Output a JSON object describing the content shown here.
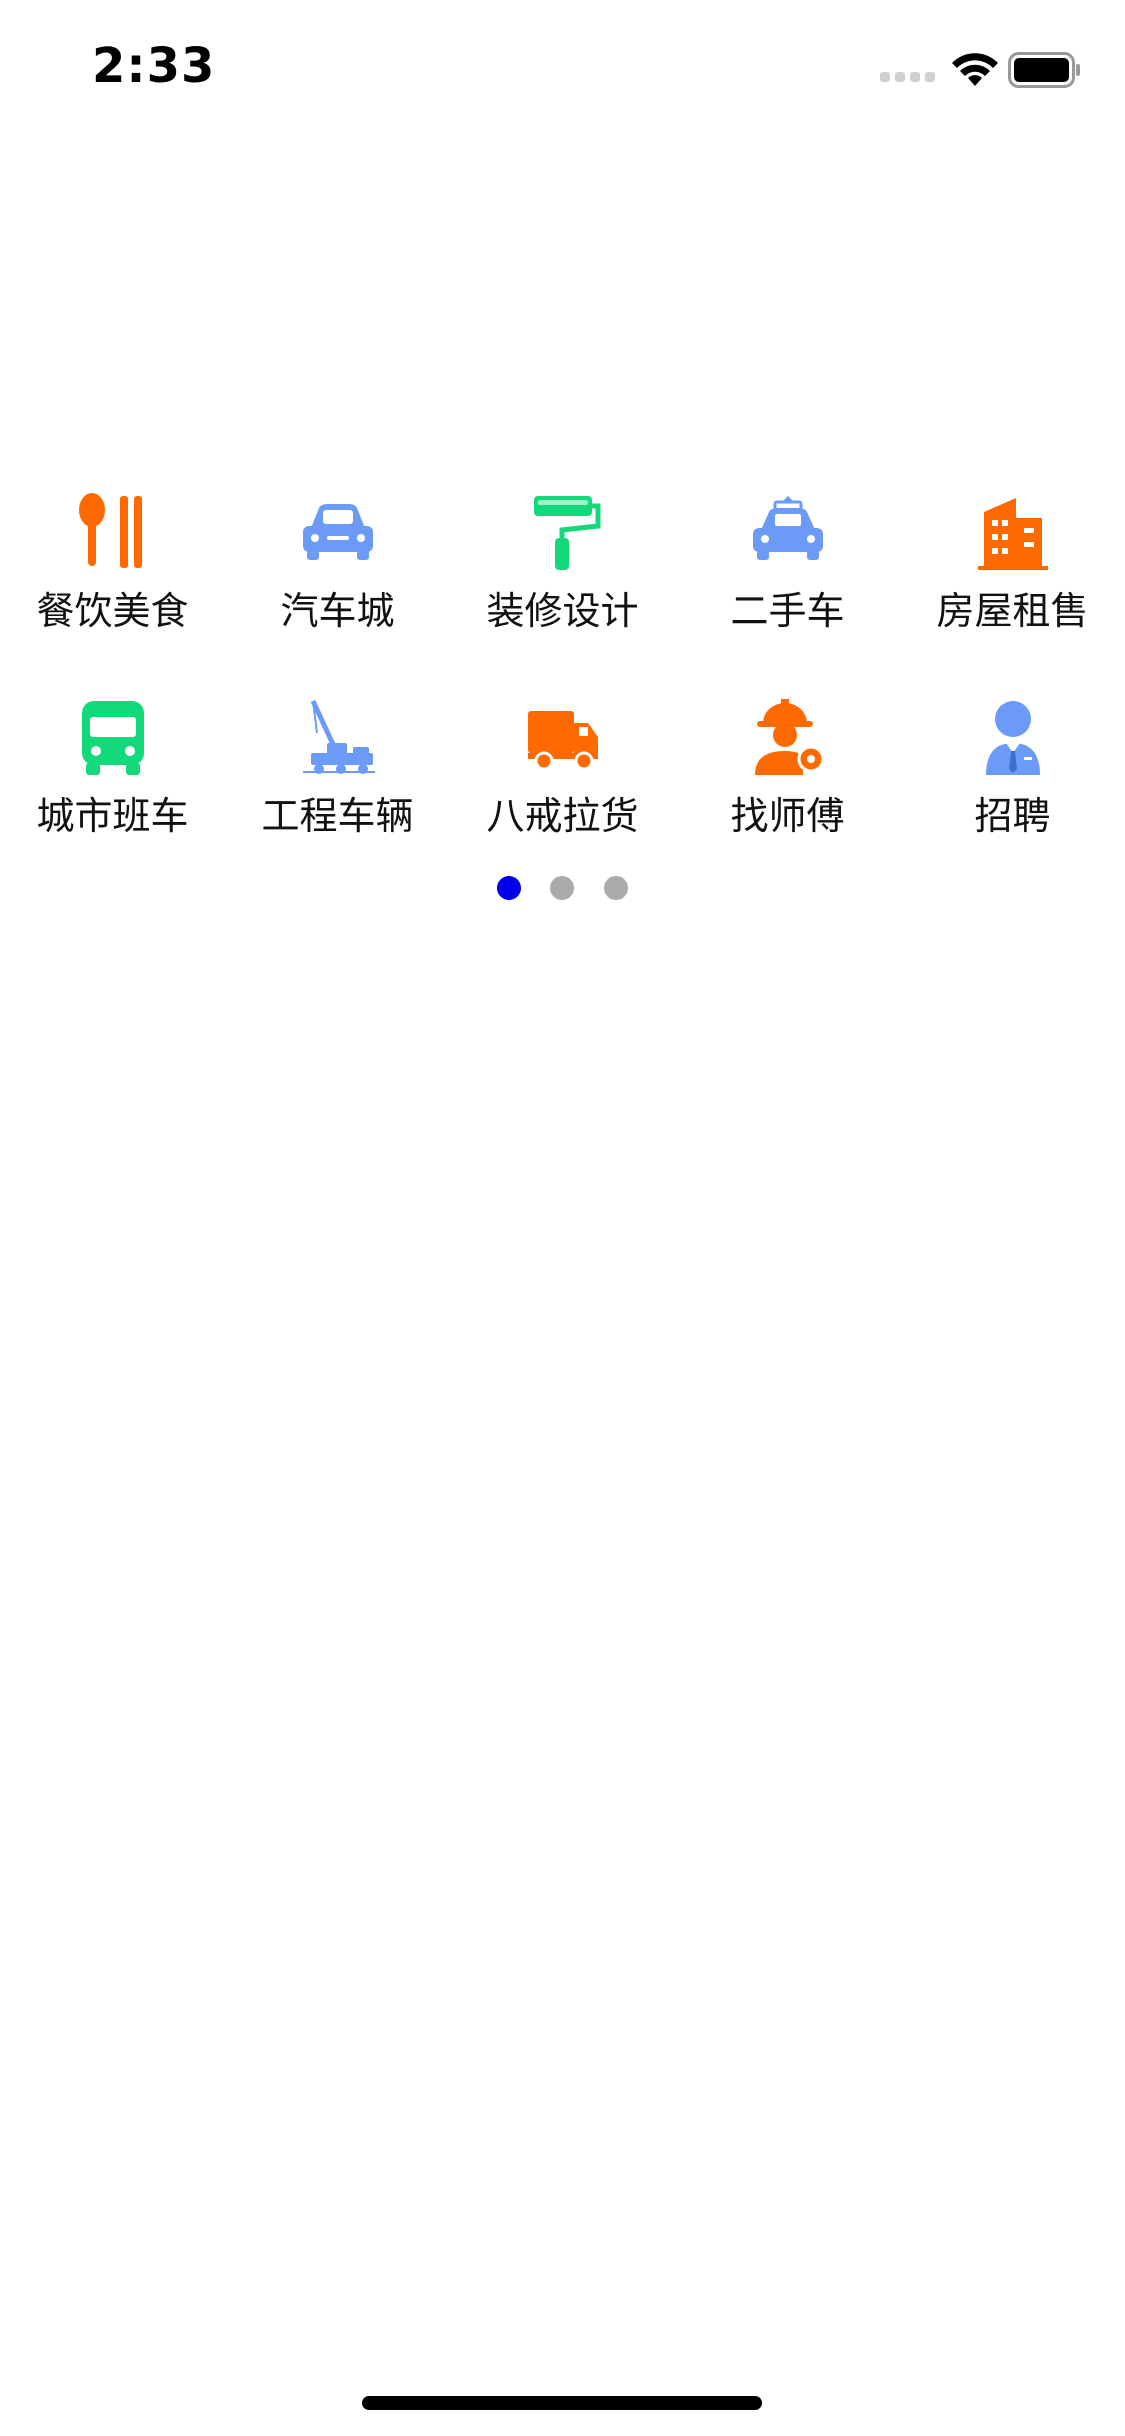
{
  "status_bar": {
    "time": "2:33"
  },
  "colors": {
    "orange": "#FF6A00",
    "blue": "#6B9BF7",
    "green": "#14D97A",
    "dot_active": "#0000EE",
    "dot_inactive": "#AAAAAA"
  },
  "grid": {
    "rows": [
      {
        "items": [
          {
            "label": "餐饮美食",
            "icon": "spoon-chopsticks-icon"
          },
          {
            "label": "汽车城",
            "icon": "car-icon"
          },
          {
            "label": "装修设计",
            "icon": "paint-roller-icon"
          },
          {
            "label": "二手车",
            "icon": "used-car-icon"
          },
          {
            "label": "房屋租售",
            "icon": "building-icon"
          }
        ]
      },
      {
        "items": [
          {
            "label": "城市班车",
            "icon": "bus-icon"
          },
          {
            "label": "工程车辆",
            "icon": "crane-truck-icon"
          },
          {
            "label": "八戒拉货",
            "icon": "delivery-truck-icon"
          },
          {
            "label": "找师傅",
            "icon": "worker-icon"
          },
          {
            "label": "招聘",
            "icon": "recruit-person-icon"
          }
        ]
      }
    ]
  },
  "pagination": {
    "total_pages": 3,
    "current_page": 1
  }
}
